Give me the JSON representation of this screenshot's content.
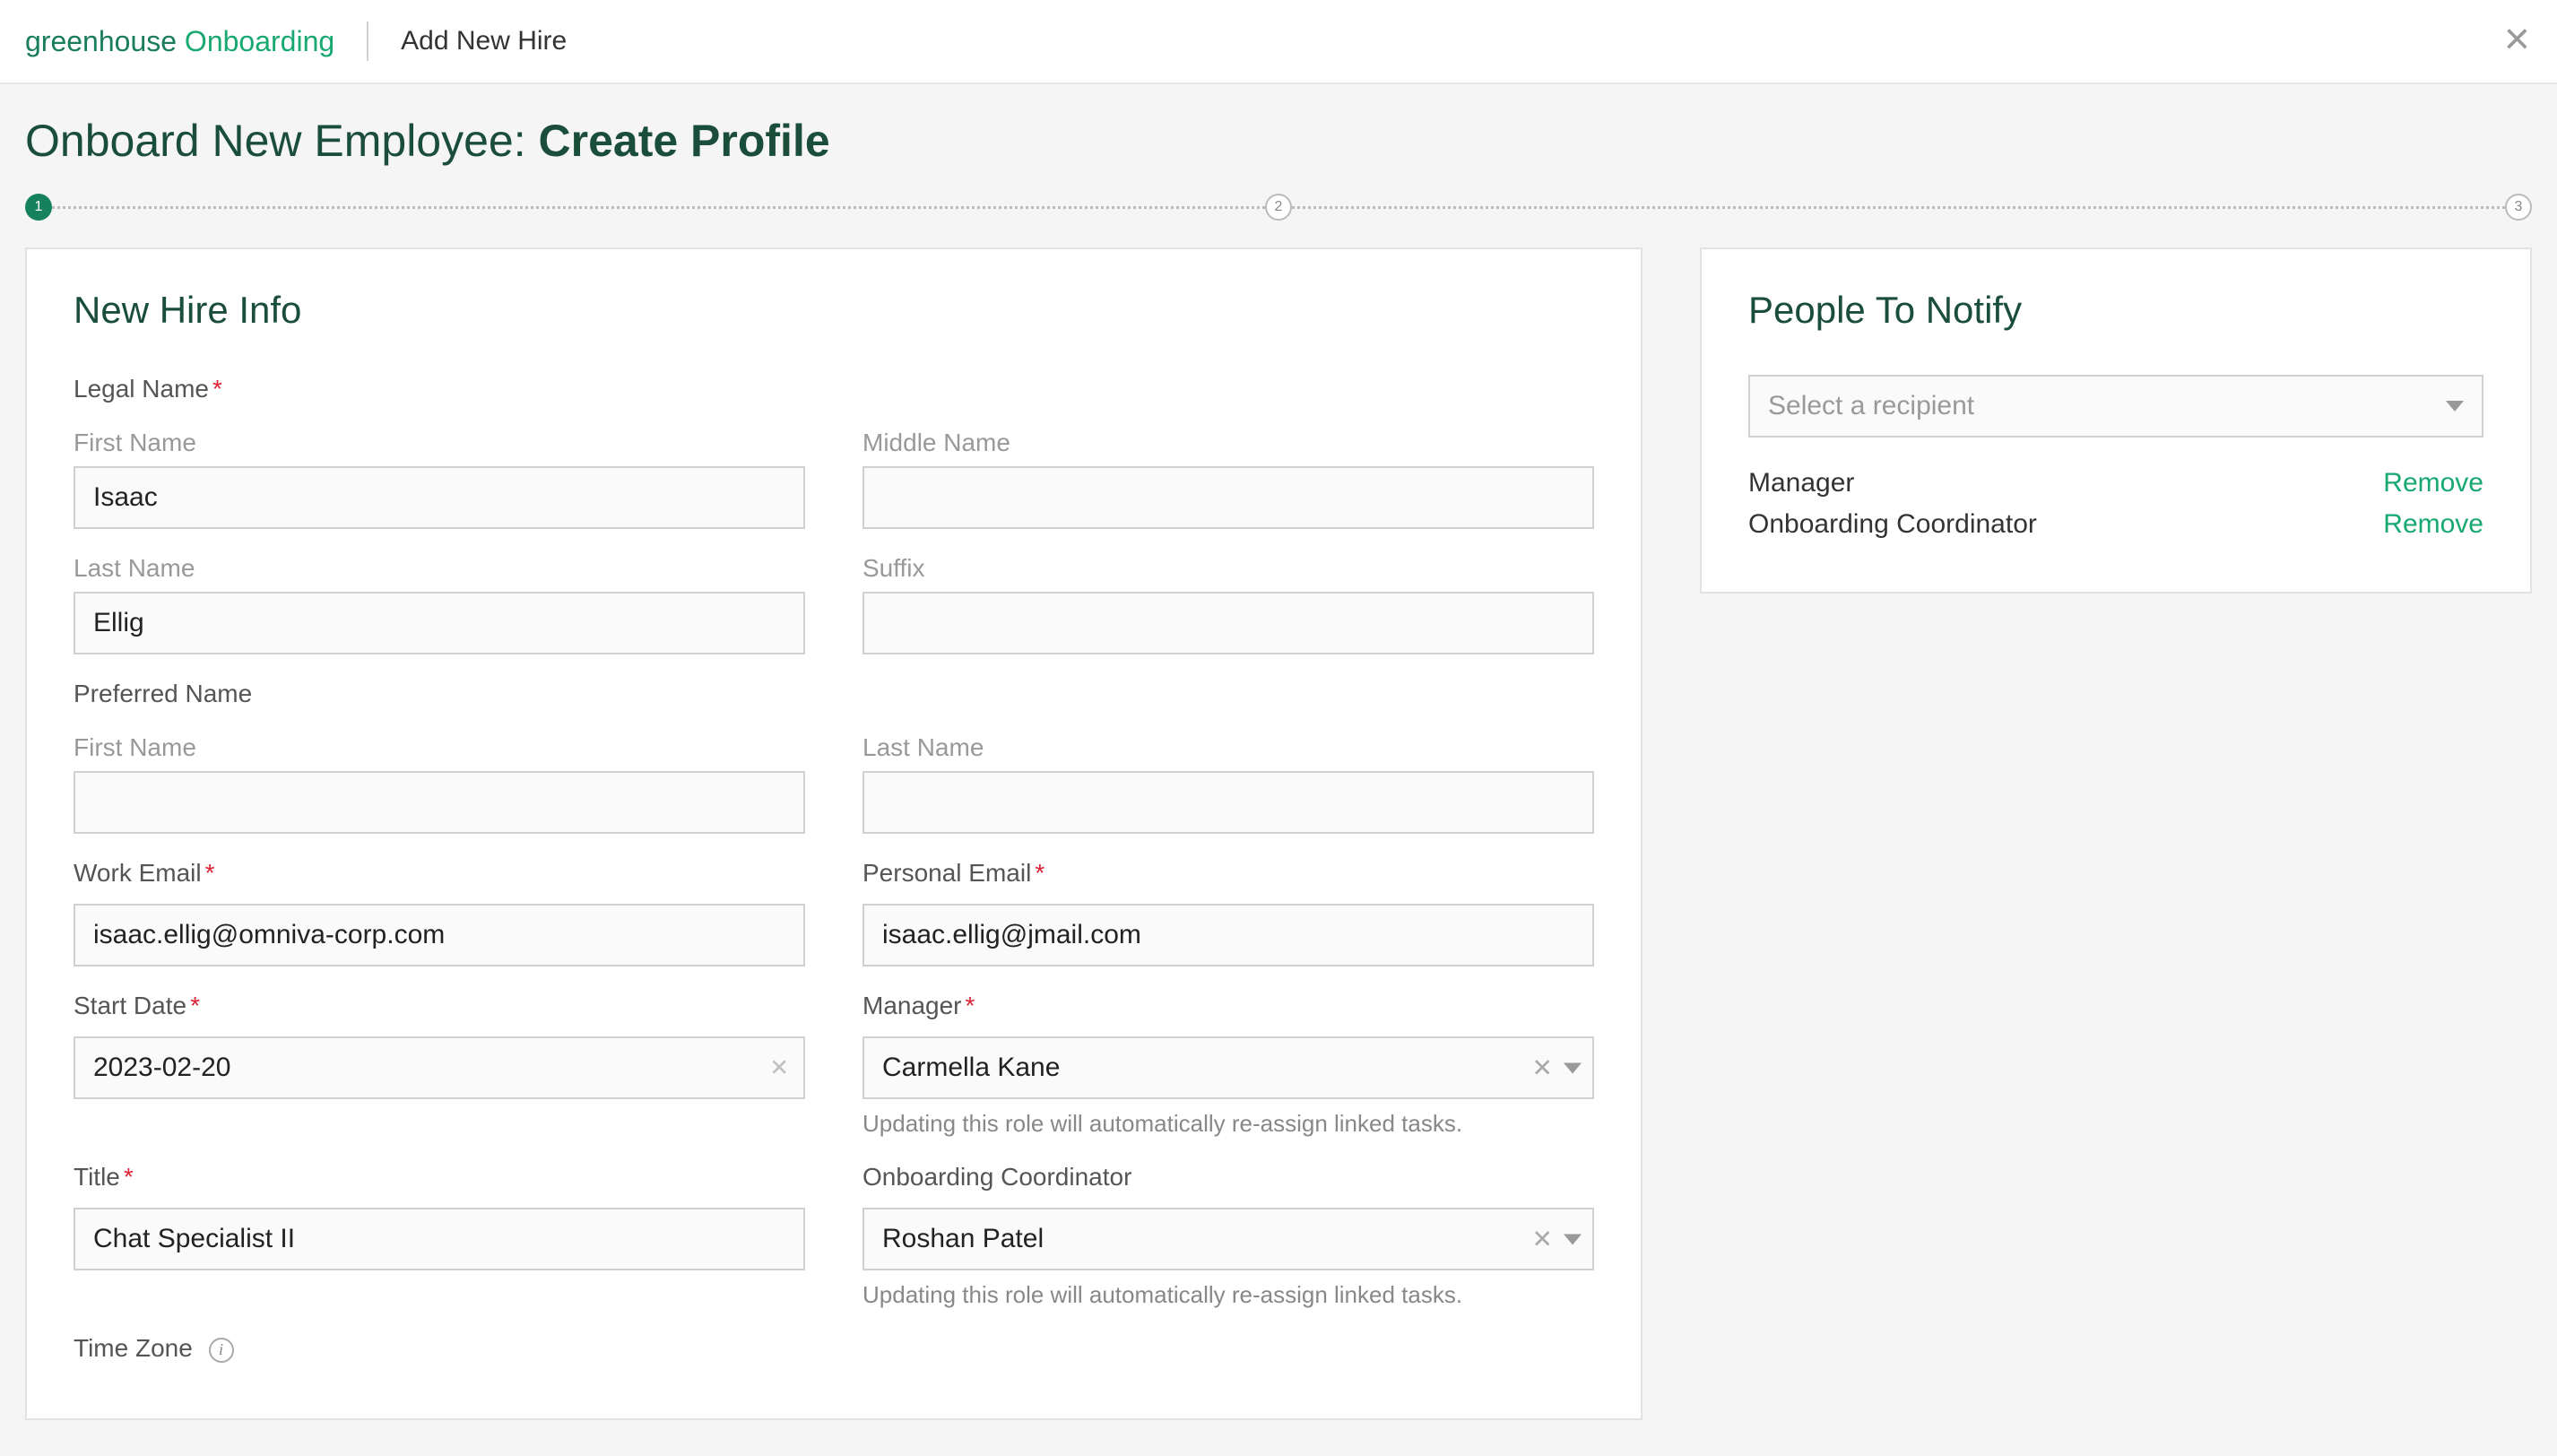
{
  "header": {
    "logo_main": "greenhouse",
    "logo_sub": "Onboarding",
    "subtitle": "Add New Hire"
  },
  "page": {
    "title_prefix": "Onboard New Employee: ",
    "title_bold": "Create Profile"
  },
  "stepper": {
    "s1": "1",
    "s2": "2",
    "s3": "3"
  },
  "main": {
    "title": "New Hire Info",
    "legal_name_label": "Legal Name",
    "first_name_label": "First Name",
    "middle_name_label": "Middle Name",
    "last_name_label": "Last Name",
    "suffix_label": "Suffix",
    "preferred_name_label": "Preferred Name",
    "work_email_label": "Work Email",
    "personal_email_label": "Personal Email",
    "start_date_label": "Start Date",
    "manager_label": "Manager",
    "title_label": "Title",
    "coordinator_label": "Onboarding Coordinator",
    "timezone_label": "Time Zone",
    "reassign_helper": "Updating this role will automatically re-assign linked tasks.",
    "values": {
      "first_name": "Isaac",
      "middle_name": "",
      "last_name": "Ellig",
      "suffix": "",
      "pref_first": "",
      "pref_last": "",
      "work_email": "isaac.ellig@omniva-corp.com",
      "personal_email": "isaac.ellig@jmail.com",
      "start_date": "2023-02-20",
      "manager": "Carmella Kane",
      "title": "Chat Specialist II",
      "coordinator": "Roshan Patel"
    }
  },
  "side": {
    "title": "People To Notify",
    "placeholder": "Select a recipient",
    "rows": [
      {
        "role": "Manager",
        "remove": "Remove"
      },
      {
        "role": "Onboarding Coordinator",
        "remove": "Remove"
      }
    ]
  }
}
